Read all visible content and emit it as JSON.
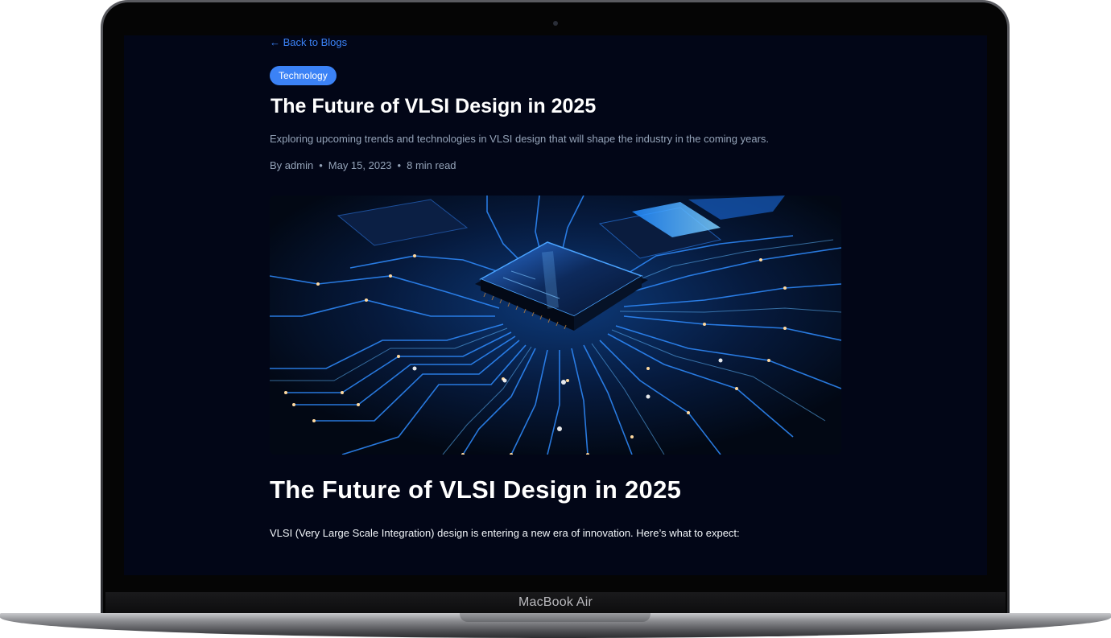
{
  "device": {
    "model_label": "MacBook Air"
  },
  "article": {
    "back_link": "← Back to Blogs",
    "category": "Technology",
    "title": "The Future of VLSI Design in 2025",
    "subtitle": "Exploring upcoming trends and technologies in VLSI design that will shape the industry in the coming years.",
    "author": "By admin",
    "separator": "•",
    "date": "May 15, 2023",
    "read_time": "8 min read",
    "hero_image": "circuit-board-chip-image",
    "body_title": "The Future of VLSI Design in 2025",
    "body_intro": "VLSI (Very Large Scale Integration) design is entering a new era of innovation. Here’s what to expect:"
  },
  "colors": {
    "page_bg": "#020617",
    "accent": "#3b82f6",
    "muted_text": "#94a3b8",
    "heading": "#ffffff"
  }
}
